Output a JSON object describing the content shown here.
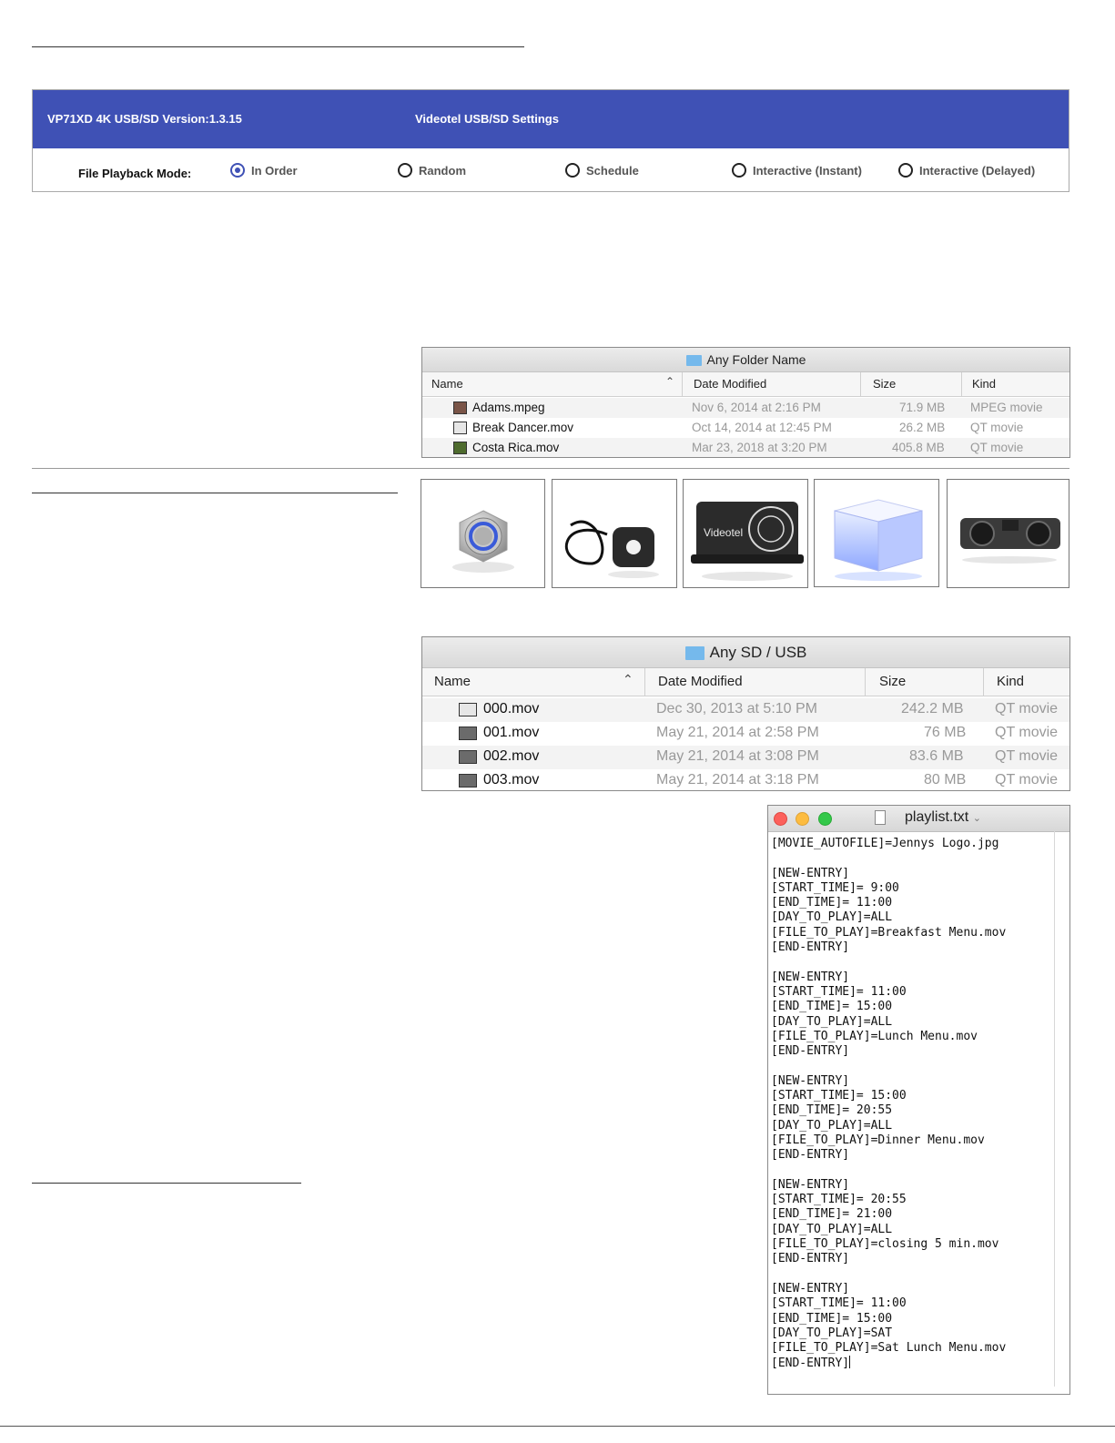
{
  "settings": {
    "version_label": "VP71XD 4K USB/SD Version:1.3.15",
    "panel_title": "Videotel USB/SD Settings",
    "mode_label": "File Playback Mode:",
    "modes": [
      "In Order",
      "Random",
      "Schedule",
      "Interactive (Instant)",
      "Interactive (Delayed)"
    ],
    "selected_mode": "In Order",
    "accent_color": "#3f51b5"
  },
  "finder1": {
    "title": "Any Folder Name",
    "columns": [
      "Name",
      "Date Modified",
      "Size",
      "Kind"
    ],
    "rows": [
      {
        "name": "Adams.mpeg",
        "date": "Nov 6, 2014 at 2:16 PM",
        "size": "71.9 MB",
        "kind": "MPEG movie"
      },
      {
        "name": "Break Dancer.mov",
        "date": "Oct 14, 2014 at 12:45 PM",
        "size": "26.2 MB",
        "kind": "QT movie"
      },
      {
        "name": "Costa Rica.mov",
        "date": "Mar 23, 2018 at 3:20 PM",
        "size": "405.8 MB",
        "kind": "QT movie"
      }
    ]
  },
  "accessories": [
    {
      "label": "illuminated-push-button"
    },
    {
      "label": "motion-sensor"
    },
    {
      "label": "wave-to-play-sensor",
      "text": "Videotel"
    },
    {
      "label": "light-box-trigger"
    },
    {
      "label": "proximity-sensor"
    }
  ],
  "finder2": {
    "title": "Any SD / USB",
    "columns": [
      "Name",
      "Date Modified",
      "Size",
      "Kind"
    ],
    "rows": [
      {
        "name": "000.mov",
        "date": "Dec 30, 2013 at 5:10 PM",
        "size": "242.2 MB",
        "kind": "QT movie"
      },
      {
        "name": "001.mov",
        "date": "May 21, 2014 at 2:58 PM",
        "size": "76 MB",
        "kind": "QT movie"
      },
      {
        "name": "002.mov",
        "date": "May 21, 2014 at 3:08 PM",
        "size": "83.6 MB",
        "kind": "QT movie"
      },
      {
        "name": "003.mov",
        "date": "May 21, 2014 at 3:18 PM",
        "size": "80 MB",
        "kind": "QT movie"
      }
    ]
  },
  "editor": {
    "filename": "playlist.txt",
    "text": "[MOVIE_AUTOFILE]=Jennys Logo.jpg\n\n[NEW-ENTRY]\n[START_TIME]= 9:00\n[END_TIME]= 11:00\n[DAY_TO_PLAY]=ALL\n[FILE_TO_PLAY]=Breakfast Menu.mov\n[END-ENTRY]\n\n[NEW-ENTRY]\n[START_TIME]= 11:00\n[END_TIME]= 15:00\n[DAY_TO_PLAY]=ALL\n[FILE_TO_PLAY]=Lunch Menu.mov\n[END-ENTRY]\n\n[NEW-ENTRY]\n[START_TIME]= 15:00\n[END_TIME]= 20:55\n[DAY_TO_PLAY]=ALL\n[FILE_TO_PLAY]=Dinner Menu.mov\n[END-ENTRY]\n\n[NEW-ENTRY]\n[START_TIME]= 20:55\n[END_TIME]= 21:00\n[DAY_TO_PLAY]=ALL\n[FILE_TO_PLAY]=closing 5 min.mov\n[END-ENTRY]\n\n[NEW-ENTRY]\n[START_TIME]= 11:00\n[END_TIME]= 15:00\n[DAY_TO_PLAY]=SAT\n[FILE_TO_PLAY]=Sat Lunch Menu.mov\n[END-ENTRY]"
  }
}
